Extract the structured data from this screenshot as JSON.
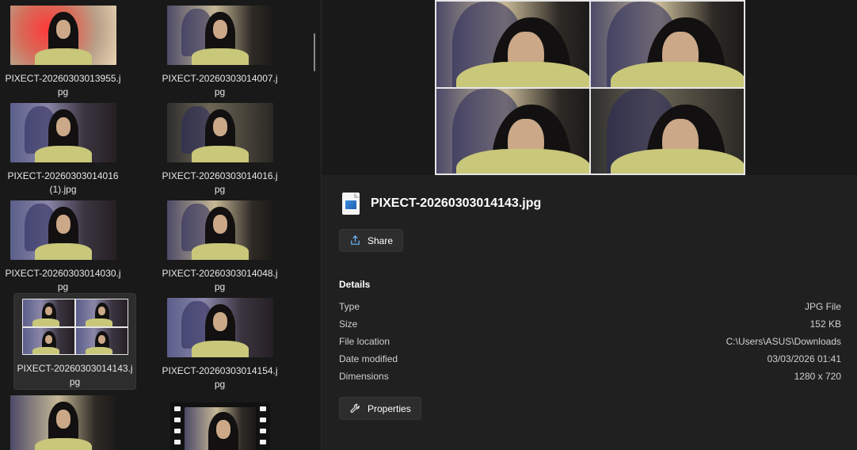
{
  "grid": {
    "items": [
      {
        "name": "PIXECT-20260303013955.jpg",
        "style": "red"
      },
      {
        "name": "PIXECT-20260303014007.jpg",
        "style": "yellow"
      },
      {
        "name": "PIXECT-20260303014016 (1).jpg",
        "style": "blue"
      },
      {
        "name": "PIXECT-20260303014016.jpg",
        "style": "dark"
      },
      {
        "name": "PIXECT-20260303014030.jpg",
        "style": "blue"
      },
      {
        "name": "PIXECT-20260303014048.jpg",
        "style": "yellow"
      },
      {
        "name": "PIXECT-20260303014143.jpg",
        "style": "collage",
        "selected": true
      },
      {
        "name": "PIXECT-20260303014154.jpg",
        "style": "blue"
      },
      {
        "name": "",
        "style": "yellow"
      }
    ]
  },
  "preview": {
    "file_name": "PIXECT-20260303014143.jpg",
    "share_label": "Share",
    "details_title": "Details",
    "details": [
      {
        "key": "Type",
        "value": "JPG File"
      },
      {
        "key": "Size",
        "value": "152 KB"
      },
      {
        "key": "File location",
        "value": "C:\\Users\\ASUS\\Downloads"
      },
      {
        "key": "Date modified",
        "value": "03/03/2026 01:41"
      },
      {
        "key": "Dimensions",
        "value": "1280 x 720"
      }
    ],
    "properties_label": "Properties"
  },
  "colors": {
    "background": "#191919",
    "panel": "#202020",
    "button": "#2d2d2d",
    "selected_tile": "#2d2d2d"
  }
}
